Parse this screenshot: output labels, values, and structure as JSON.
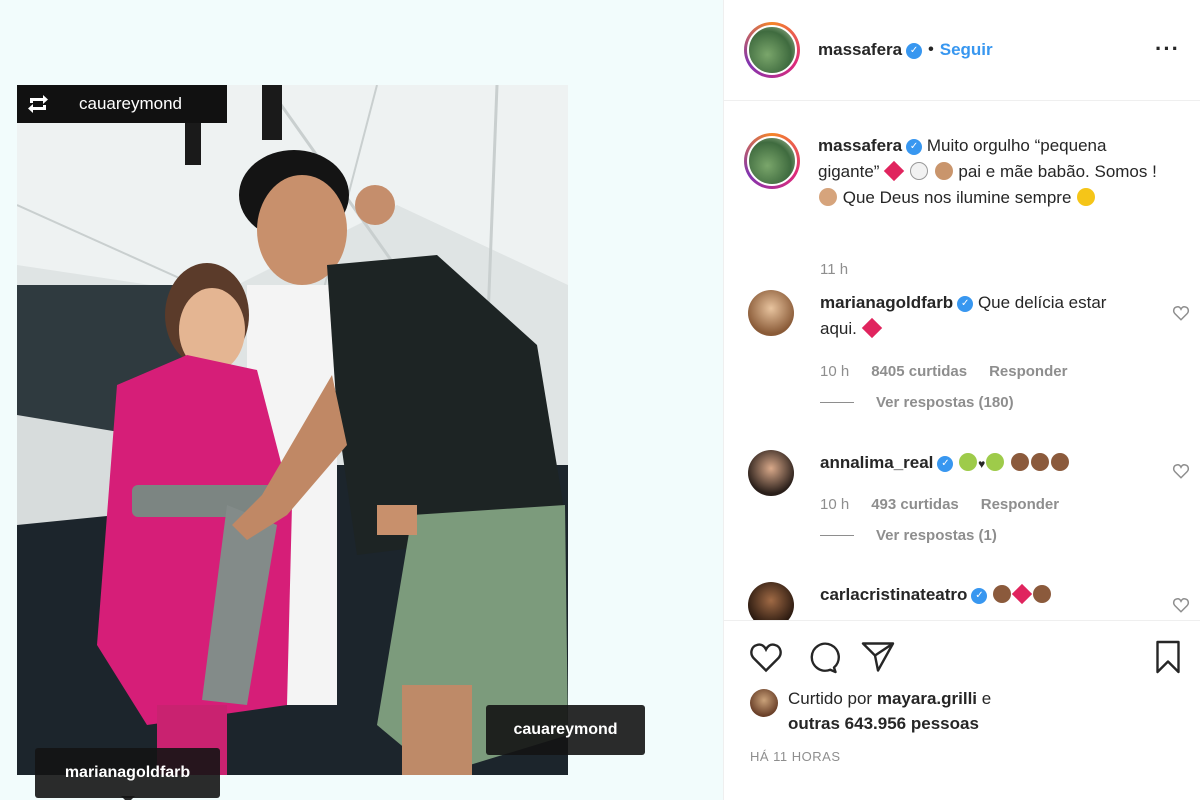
{
  "post": {
    "repost_user": "cauareymond",
    "tags": [
      "cauareymond",
      "marianagoldfarb"
    ]
  },
  "header": {
    "username": "massafera",
    "separator": "•",
    "follow_label": "Seguir",
    "more_label": "..."
  },
  "caption": {
    "username": "massafera",
    "line1": "Muito orgulho “pequena gigante”",
    "line2": "pai e mãe babão. Somos !",
    "line3": "Que Deus nos ilumine sempre",
    "time": "11 h"
  },
  "comments": [
    {
      "username": "marianagoldfarb",
      "text": "Que delícia estar aqui.",
      "time": "10 h",
      "likes": "8405 curtidas",
      "reply": "Responder",
      "replies": "Ver respostas (180)"
    },
    {
      "username": "annalima_real",
      "text": "",
      "time": "10 h",
      "likes": "493 curtidas",
      "reply": "Responder",
      "replies": "Ver respostas (1)"
    },
    {
      "username": "carlacristinateatro",
      "text": ""
    }
  ],
  "footer": {
    "liked_prefix": "Curtido por",
    "liked_user": "mayara.grilli",
    "liked_suffix": "e",
    "liked_others": "outras 643.956 pessoas",
    "timestamp": "HÁ 11 HORAS"
  },
  "colors": {
    "accent": "#3897f0",
    "muted": "#8e8e8e",
    "heart": "#e0245e"
  }
}
